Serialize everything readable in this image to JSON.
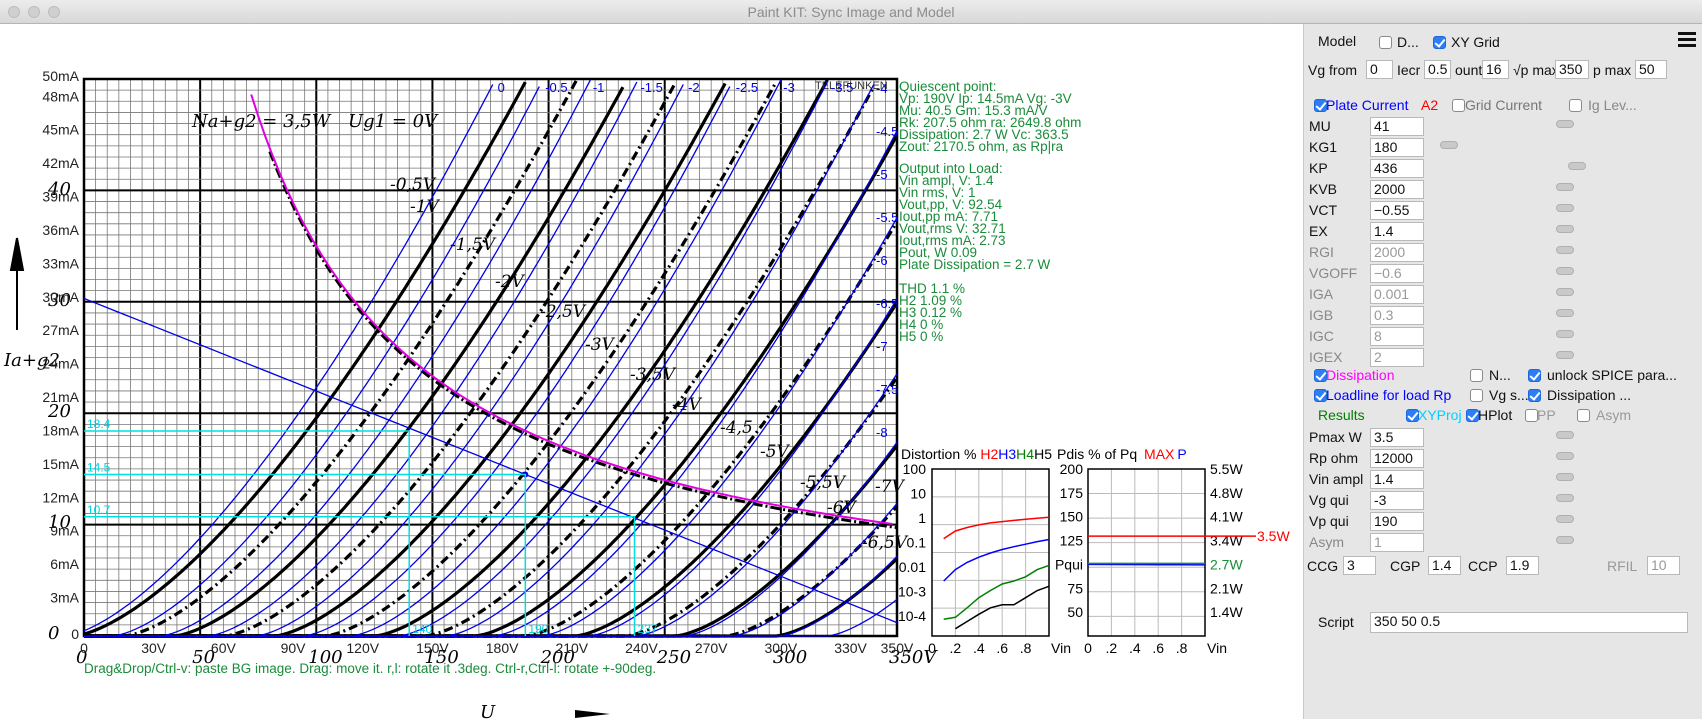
{
  "window": {
    "title": "Paint KIT: Sync Image and Model"
  },
  "plot": {
    "y_ticks": [
      "50mA",
      "48mA",
      "45mA",
      "42mA",
      "39mA",
      "36mA",
      "33mA",
      "30mA",
      "27mA",
      "24mA",
      "21mA",
      "18mA",
      "15mA",
      "12mA",
      "9mA",
      "6mA",
      "3mA",
      "0"
    ],
    "x_ticks": [
      "0",
      "30V",
      "60V",
      "90V",
      "120V",
      "150V",
      "180V",
      "210V",
      "240V",
      "270V",
      "300V",
      "330V",
      "350V"
    ],
    "vg_curve_labels": [
      "0",
      "-0.5",
      "-1",
      "-1.5",
      "-2",
      "-2.5",
      "-3",
      "-3.5",
      "-4",
      "-4.5",
      "-5",
      "-5.5",
      "-6",
      "-6.5",
      "-7",
      "-7.5",
      "-8"
    ],
    "quiescent_title": "Quiescent point:",
    "quiescent_lines": [
      "Vp: 190V  Ip: 14.5mA  Vg: -3V",
      "Mu: 40.5 Gm: 15.3 mA/V",
      "Rk: 207.5 ohm ra: 2649.8 ohm",
      "Dissipation: 2.7 W Vc: 363.5",
      "Zout: 2170.5 ohm, as Rp|ra"
    ],
    "output_title": "Output into Load:",
    "output_lines": [
      "Vin ampl, V: 1.4",
      "Vin rms,  V: 1",
      "Vout,pp,   V: 92.54",
      "Iout,pp   mA: 7.71",
      "Vout,rms   V: 32.71",
      "Iout,rms  mA: 2.73",
      "Pout, W      0.09",
      "Plate Dissipation = 2.7 W"
    ],
    "thd_lines": [
      "THD 1.1 %",
      "  H2 1.09 %",
      "  H3 0.12 %",
      "  H4 0 %",
      "  H5 0 %"
    ],
    "marker_values": [
      "18.4",
      "14.5",
      "10.7",
      "140",
      "190",
      "237"
    ],
    "hint": "Drag&Drop/Ctrl-v: paste BG image. Drag: move it. r,l: rotate it .3deg. Ctrl-r,Ctrl-l: rotate +-90deg.",
    "bg_image_text": {
      "na_g2": "Na+g2 = 3,5W",
      "ug1": "Ug1 = 0V",
      "ia_g2": "Ia+g2",
      "vg_labels": [
        "-0,5V",
        "-1V",
        "-1,5V",
        "-2V",
        "-2,5V",
        "-3V",
        "-3,5V",
        "-4V",
        "-4,5",
        "-5V",
        "-5,5V",
        "-6V",
        "-6,5V",
        "-7V"
      ],
      "bg_x_ticks": [
        "0",
        "50",
        "100",
        "150",
        "200",
        "250",
        "300",
        "350V"
      ],
      "bg_y_ticks": [
        "40",
        "30",
        "20",
        "10",
        "0"
      ],
      "telefunken": "TELEFUNKEN",
      "bottom_letter": "U"
    }
  },
  "distortion": {
    "title_prefix": "Distortion % ",
    "h2": "H2",
    "h3": "H3",
    "h4": "H4",
    "h5": "H5",
    "y_ticks": [
      "100",
      "10",
      "1",
      "0.1",
      "0.01",
      "10-3",
      "10-4"
    ],
    "x_ticks": [
      "0",
      ".2",
      ".4",
      ".6",
      ".8",
      "Vin"
    ],
    "colors": {
      "h2": "#ff0000",
      "h3": "#0000ff",
      "h4": "#008000",
      "h5": "#000000"
    },
    "chart_data": {
      "type": "line",
      "xlabel": "Vin",
      "xlim": [
        0,
        1
      ],
      "ylim_log": [
        0.0001,
        100
      ],
      "series": [
        {
          "name": "H2",
          "x": [
            0.1,
            0.2,
            0.3,
            0.4,
            0.5,
            0.6,
            0.7,
            0.8,
            0.9,
            1.0
          ],
          "values": [
            0.12,
            0.25,
            0.35,
            0.45,
            0.55,
            0.62,
            0.7,
            0.78,
            0.85,
            0.95
          ]
        },
        {
          "name": "H3",
          "x": [
            0.1,
            0.2,
            0.3,
            0.4,
            0.5,
            0.6,
            0.7,
            0.8,
            0.9,
            1.0
          ],
          "values": [
            0.002,
            0.006,
            0.012,
            0.02,
            0.03,
            0.042,
            0.055,
            0.07,
            0.09,
            0.11
          ]
        },
        {
          "name": "H4",
          "x": [
            0.1,
            0.2,
            0.3,
            0.4,
            0.5,
            0.6,
            0.7,
            0.8,
            0.9,
            1.0
          ],
          "values": [
            5e-05,
            6e-05,
            0.00015,
            0.0004,
            0.0008,
            0.0015,
            0.002,
            0.003,
            0.006,
            0.009
          ]
        },
        {
          "name": "H5",
          "x": [
            0.2,
            0.3,
            0.4,
            0.5,
            0.6,
            0.7,
            0.8,
            0.9,
            1.0
          ],
          "values": [
            2e-05,
            4e-05,
            8e-05,
            0.00015,
            0.0002,
            0.0002,
            0.0004,
            0.0008,
            0.0012
          ]
        }
      ]
    }
  },
  "pdis": {
    "title_prefix": "Pdis % of Pq ",
    "max": "MAX",
    "p": "P",
    "y_ticks": [
      "200",
      "175",
      "150",
      "125",
      "Pqui",
      "75",
      "50"
    ],
    "right_ticks": [
      "5.5W",
      "4.8W",
      "4.1W",
      "3.4W",
      "2.7W",
      "2.1W",
      "1.4W"
    ],
    "max_label": "3.5W",
    "x_ticks": [
      "0",
      ".2",
      ".4",
      ".6",
      ".8",
      "Vin"
    ],
    "chart_data": {
      "type": "line",
      "xlabel": "Vin",
      "xlim": [
        0,
        1
      ],
      "ylim": [
        25,
        200
      ],
      "series": [
        {
          "name": "MAX",
          "x": [
            0,
            1
          ],
          "values": [
            129.6,
            129.6
          ]
        },
        {
          "name": "P",
          "x": [
            0,
            0.2,
            0.4,
            0.6,
            0.8,
            1.0
          ],
          "values": [
            100,
            99.9,
            99.8,
            99.7,
            99.6,
            99.5
          ]
        }
      ]
    }
  },
  "panel": {
    "model_label": "Model",
    "d_label": "D...",
    "xy_grid_label": "XY Grid",
    "vg_from_label": "Vg from",
    "vg_from": "0",
    "incr_label": "Iecr",
    "incr": "0.5",
    "count_label": "ount",
    "count": "16",
    "vp_max_label": "√p max",
    "vp_max": "350",
    "ip_max_label": "p max",
    "ip_max": "50",
    "plate_current": "Plate Current",
    "a2": "A2",
    "grid_current": "Grid Current",
    "ig_lev": "Ig Lev...",
    "params": [
      {
        "name": "MU",
        "value": "41",
        "thumb": 0.5,
        "enabled": true
      },
      {
        "name": "KG1",
        "value": "180",
        "thumb": 0.02,
        "enabled": true
      },
      {
        "name": "KP",
        "value": "436",
        "thumb": 0.55,
        "enabled": true
      },
      {
        "name": "KVB",
        "value": "2000",
        "thumb": 0.5,
        "enabled": true
      },
      {
        "name": "VCT",
        "value": "−0.55",
        "thumb": 0.5,
        "enabled": true
      },
      {
        "name": "EX",
        "value": "1.4",
        "thumb": 0.5,
        "enabled": true
      },
      {
        "name": "RGI",
        "value": "2000",
        "thumb": 0.5,
        "enabled": false
      },
      {
        "name": "VGOFF",
        "value": "−0.6",
        "thumb": 0.5,
        "enabled": false
      },
      {
        "name": "IGA",
        "value": "0.001",
        "thumb": 0.5,
        "enabled": false
      },
      {
        "name": "IGB",
        "value": "0.3",
        "thumb": 0.5,
        "enabled": false
      },
      {
        "name": "IGC",
        "value": "8",
        "thumb": 0.5,
        "enabled": false
      },
      {
        "name": "IGEX",
        "value": "2",
        "thumb": 0.5,
        "enabled": false
      }
    ],
    "dissipation": "Dissipation",
    "n_label": "N...",
    "unlock_spice": "unlock SPICE para...",
    "loadline": "Loadline for load Rp",
    "vg_s": "Vg s...",
    "dissipation2": "Dissipation ...",
    "results": "Results",
    "xyproj": "XYProj",
    "hplot": "HPlot",
    "pp": "PP",
    "asym": "Asym",
    "load_params": [
      {
        "name": "Pmax W",
        "value": "3.5",
        "thumb": 0.5,
        "enabled": true
      },
      {
        "name": "Rp ohm",
        "value": "12000",
        "thumb": 0.5,
        "enabled": true
      },
      {
        "name": "Vin ampl",
        "value": "1.4",
        "thumb": 0.5,
        "enabled": true
      },
      {
        "name": "Vg qui",
        "value": "-3",
        "thumb": 0.5,
        "enabled": true
      },
      {
        "name": "Vp qui",
        "value": "190",
        "thumb": 0.5,
        "enabled": true
      },
      {
        "name": "Asym",
        "value": "1",
        "thumb": 0.5,
        "enabled": false
      }
    ],
    "ccg_label": "CCG",
    "ccg": "3",
    "cgp_label": "CGP",
    "cgp": "1.4",
    "ccp_label": "CCP",
    "ccp": "1.9",
    "rfil_label": "RFIL",
    "rfil": "10",
    "script_label": "Script",
    "script": "350 50 0.5"
  }
}
